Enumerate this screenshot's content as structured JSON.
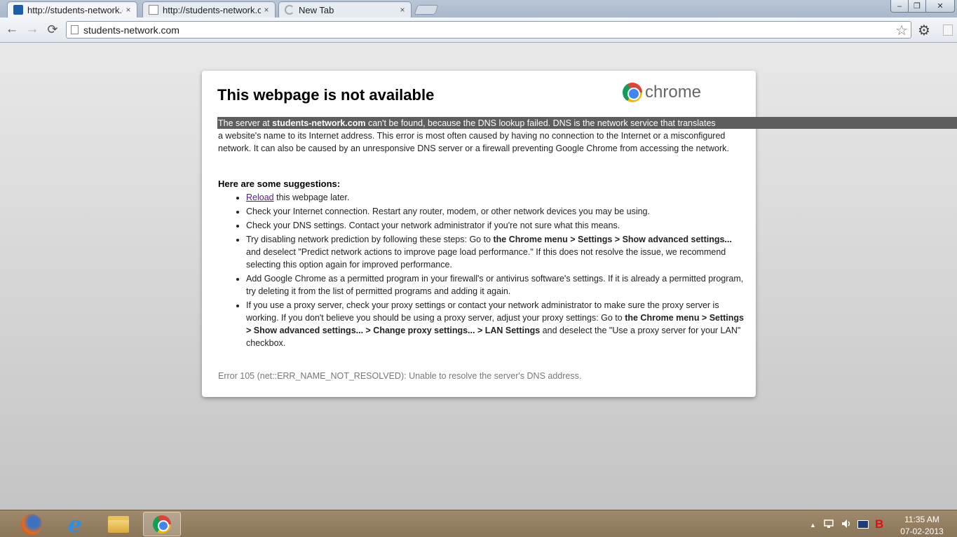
{
  "browser": {
    "tabs": [
      {
        "label": "http://students-network.c",
        "close": "×"
      },
      {
        "label": "http://students-network.c",
        "close": "×"
      },
      {
        "label": "New Tab",
        "close": "×"
      }
    ],
    "window_controls": {
      "minimize": "–",
      "maximize": "❐",
      "close": "✕"
    },
    "toolbar": {
      "back": "←",
      "forward": "→",
      "reload": "⟳",
      "url": "students-network.com",
      "star": "☆",
      "menu": "⚙"
    }
  },
  "error_page": {
    "title": "This webpage is not available",
    "brand": "chrome",
    "description": {
      "line1_prefix": "The server at ",
      "host": "students-network.com",
      "line1_suffix": " can't be found, because the DNS lookup failed. DNS is the network service that translates",
      "rest": "a website's name to its Internet address. This error is most often caused by having no connection to the Internet or a misconfigured network. It can also be caused by an unresponsive DNS server or a firewall preventing Google Chrome from accessing the network."
    },
    "suggestions_heading": "Here are some suggestions:",
    "suggestions": {
      "reload_link": "Reload",
      "reload_rest": " this webpage later.",
      "item2": "Check your Internet connection. Restart any router, modem, or other network devices you may be using.",
      "item3": "Check your DNS settings. Contact your network administrator if you're not sure what this means.",
      "item4_a": "Try disabling network prediction by following these steps: Go to ",
      "item4_b": "the Chrome menu > Settings > Show advanced settings...",
      "item4_c": " and deselect \"Predict network actions to improve page load performance.\" If this does not resolve the issue, we recommend selecting this option again for improved performance.",
      "item5": "Add Google Chrome as a permitted program in your firewall's or antivirus software's settings. If it is already a permitted program, try deleting it from the list of permitted programs and adding it again.",
      "item6_a": "If you use a proxy server, check your proxy settings or contact your network administrator to make sure the proxy server is working. If you don't believe you should be using a proxy server, adjust your proxy settings: Go to ",
      "item6_b": "the Chrome menu > Settings > Show advanced settings... > Change proxy settings... > LAN Settings",
      "item6_c": " and deselect the \"Use a proxy server for your LAN\" checkbox."
    },
    "error_code": "Error 105 (net::ERR_NAME_NOT_RESOLVED): Unable to resolve the server's DNS address."
  },
  "taskbar": {
    "ie_glyph": "e",
    "tray_arrow": "▲",
    "tray_b": "B",
    "time": "11:35 AM",
    "date": "07-02-2013"
  },
  "colors": {
    "highlight": "#5e5e5e",
    "link": "#551a8b",
    "taskbar": "#8a7558"
  }
}
